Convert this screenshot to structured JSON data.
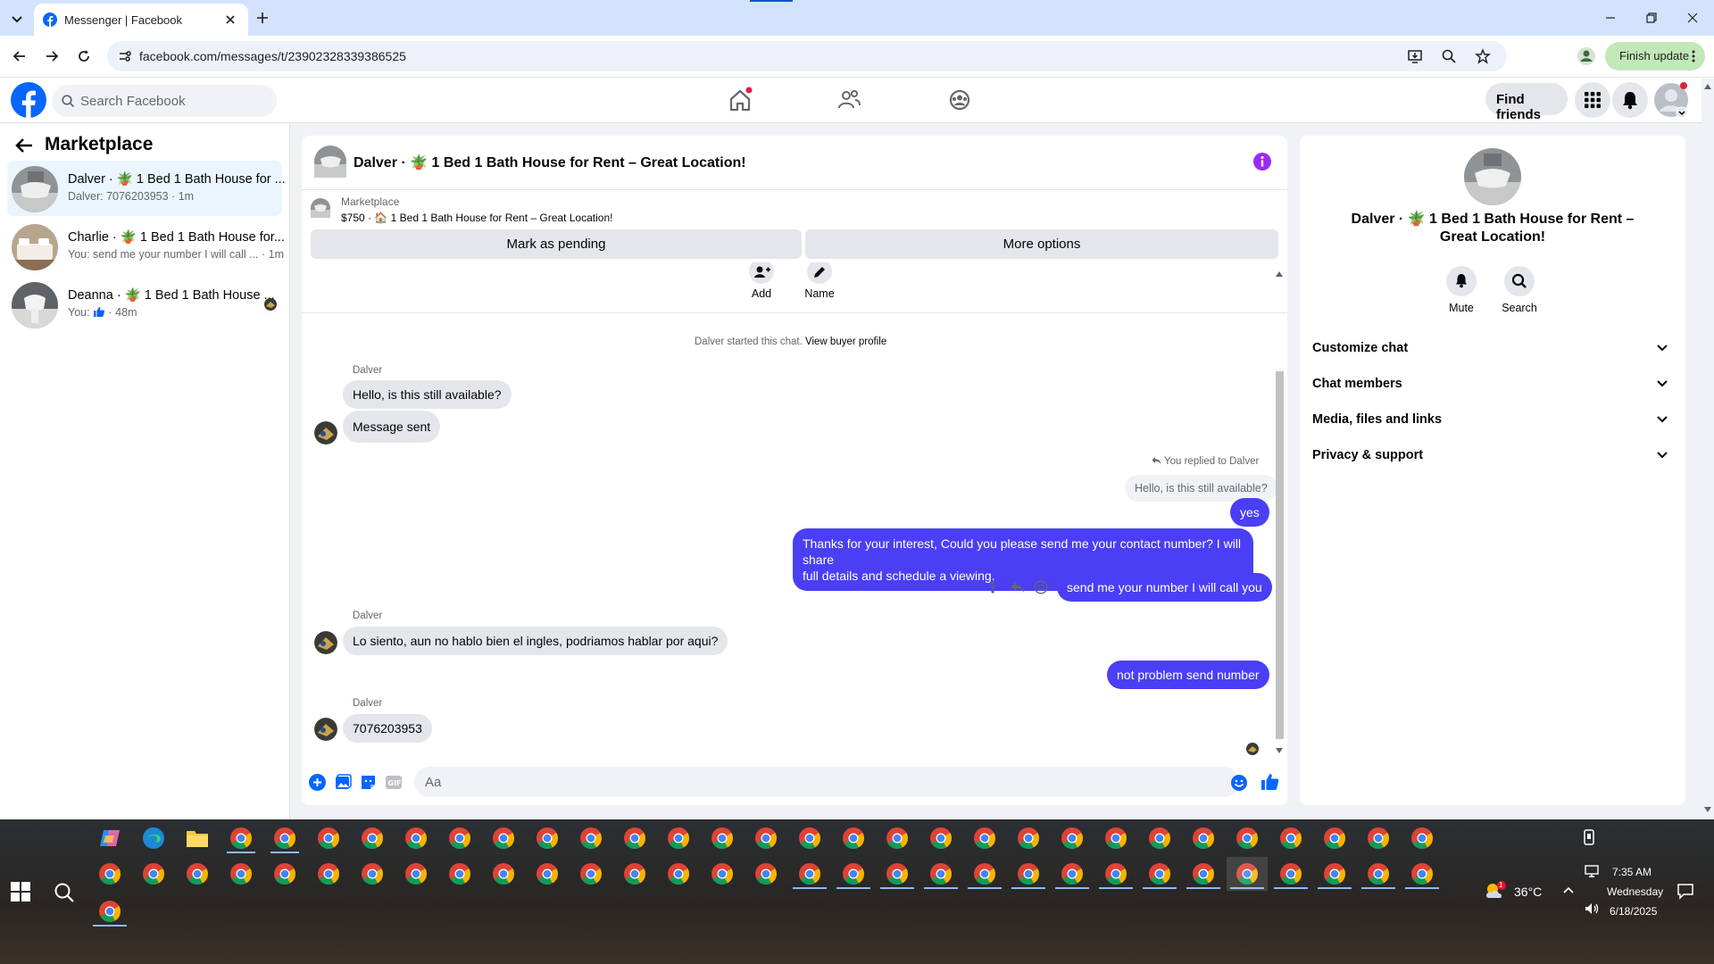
{
  "browser": {
    "tab_title": "Messenger | Facebook",
    "url": "facebook.com/messages/t/23902328339386525",
    "finish_update": "Finish update"
  },
  "fb": {
    "search_placeholder": "Search Facebook",
    "find_friends": "Find friends"
  },
  "sidebar": {
    "title": "Marketplace",
    "chats": [
      {
        "name": "Dalver · 🪴 1 Bed 1 Bath House for ...",
        "preview": "Dalver: 7076203953 · 1m"
      },
      {
        "name": "Charlie · 🪴 1 Bed 1 Bath House for...",
        "preview": "You: send me your number I will call ... · 1m"
      },
      {
        "name": "Deanna · 🪴 1 Bed 1 Bath House ...",
        "preview_prefix": "You:",
        "preview_suffix": "· 48m"
      }
    ]
  },
  "chat": {
    "title": "Dalver · 🪴 1 Bed 1 Bath House for Rent – Great Location!",
    "marketplace_label": "Marketplace",
    "listing_line": "$750 · 🏠 1 Bed 1 Bath House for Rent – Great Location!",
    "mark_pending": "Mark as pending",
    "more_options": "More options",
    "mini_add": "Add",
    "mini_name": "Name",
    "started_text": "Dalver started this chat.",
    "view_buyer": "View buyer profile",
    "sender": "Dalver",
    "msg1": "Hello, is this still available?",
    "msg2": "Message sent",
    "replied_to": "You replied to Dalver",
    "quoted": "Hello, is this still available?",
    "out1": "yes",
    "out2a": "Thanks for your interest, Could you please send me your contact number? I will share",
    "out2b": "full details and schedule a viewing.",
    "out3": "send me your number I will call you",
    "msg3": "Lo siento, aun no hablo bien el ingles, podriamos hablar por aqui?",
    "out4": "not problem send number",
    "msg4": "7076203953",
    "composer_placeholder": "Aa"
  },
  "info": {
    "name": "Dalver · 🪴 1 Bed 1 Bath House for Rent – Great Location!",
    "mute": "Mute",
    "search": "Search",
    "rows": [
      "Customize chat",
      "Chat members",
      "Media, files and links",
      "Privacy & support"
    ]
  },
  "taskbar": {
    "weather": "36°C",
    "time": "7:35 AM",
    "day": "Wednesday",
    "date": "6/18/2025",
    "weather_badge": "1"
  },
  "colors": {
    "fb_blue": "#0866ff",
    "outgoing_bubble": "#4a3ff5",
    "info_purple": "#9b2cf5"
  }
}
